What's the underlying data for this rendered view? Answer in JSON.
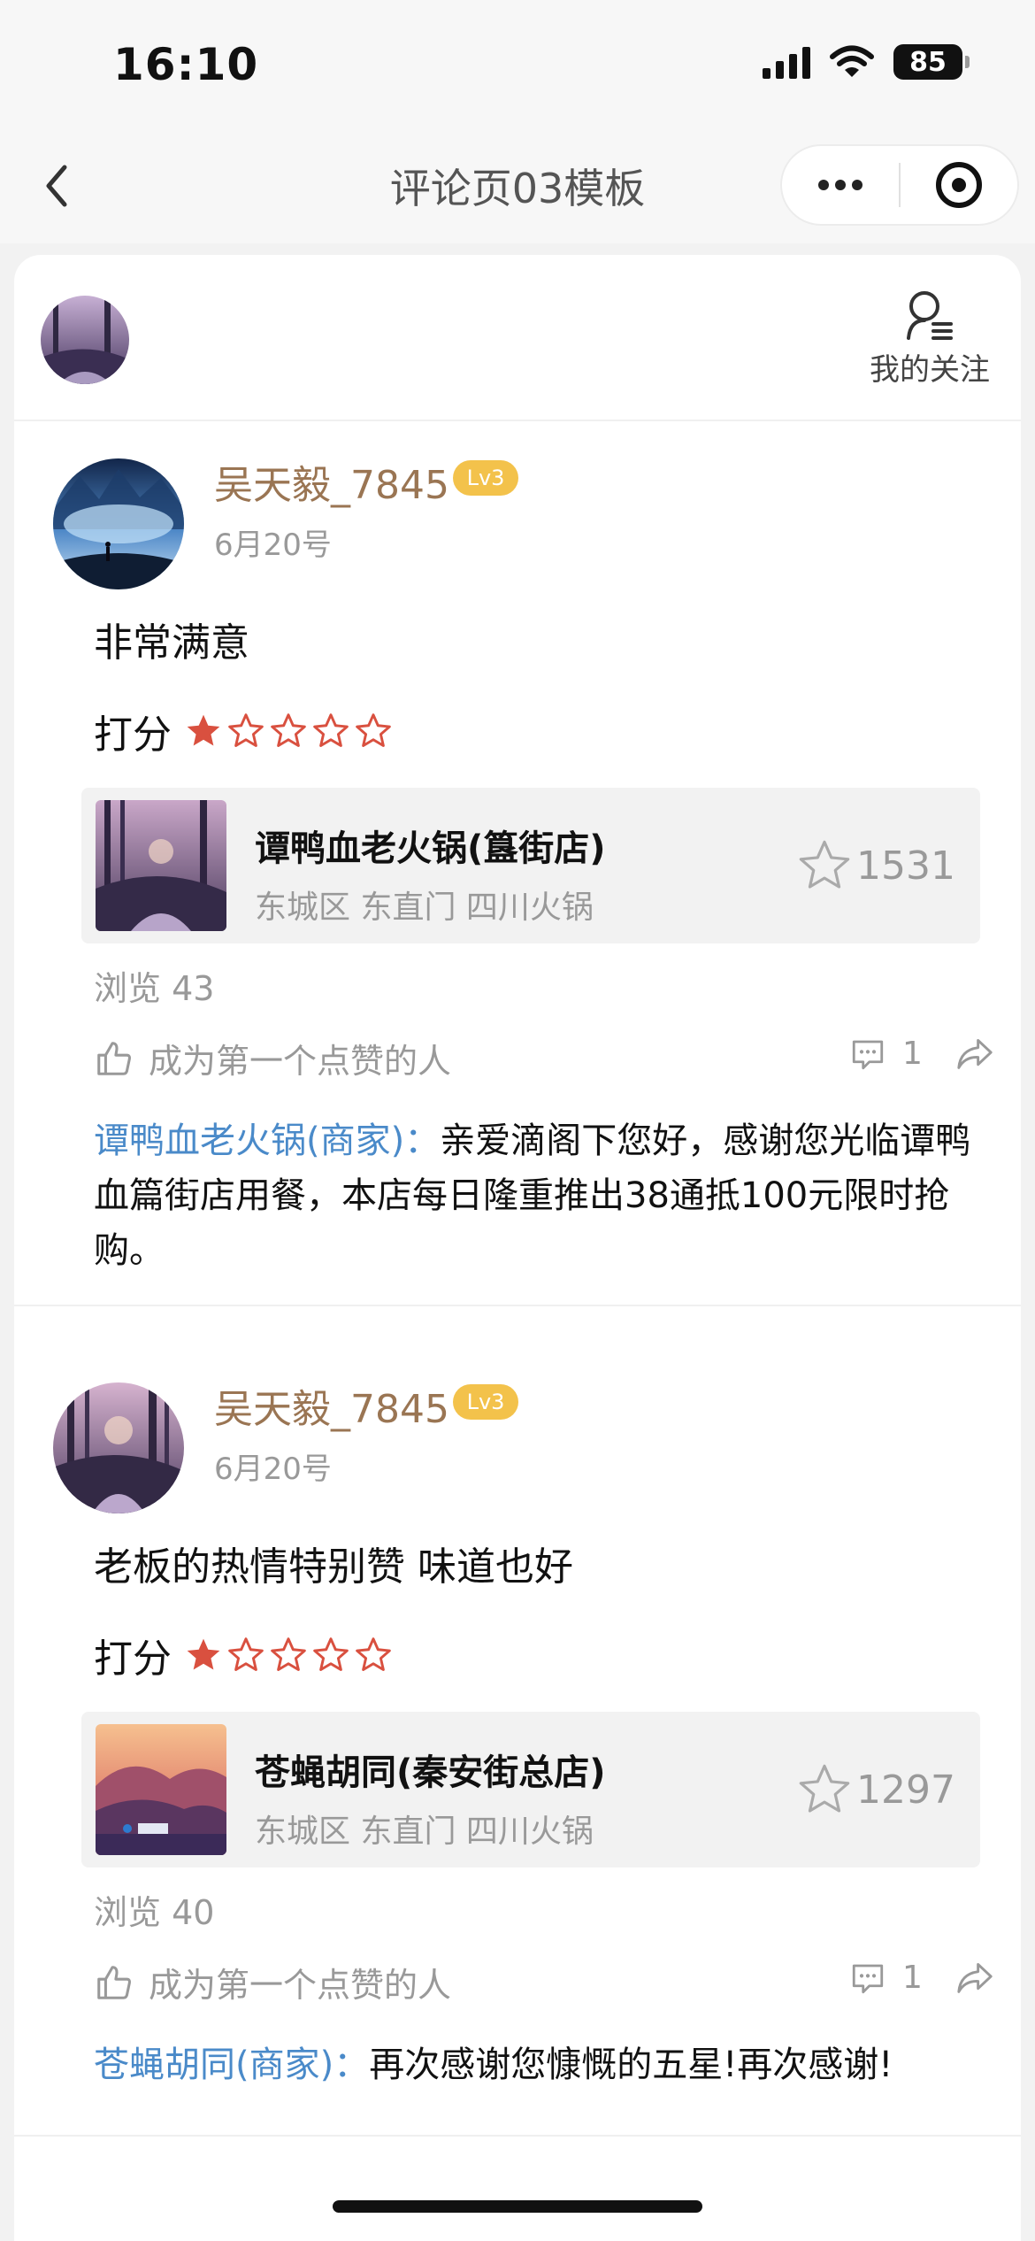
{
  "status_bar": {
    "time": "16:10",
    "battery": "85"
  },
  "nav": {
    "title": "评论页03模板"
  },
  "header": {
    "follow_label": "我的关注"
  },
  "reviews": [
    {
      "username": "吴天毅_7845",
      "level": "Lv3",
      "date": "6月20号",
      "text": "非常满意",
      "score_label": "打分",
      "rating": 1,
      "max_rating": 5,
      "shop": {
        "name": "谭鸭血老火锅(簋街店)",
        "location": "东城区 东直门 四川火锅",
        "fav_count": "1531"
      },
      "views": "浏览 43",
      "like_text": "成为第一个点赞的人",
      "comment_count": "1",
      "reply_merchant": "谭鸭血老火锅(商家)：",
      "reply_text": "亲爱滴阁下您好，感谢您光临谭鸭血篇街店用餐，本店每日隆重推出38通抵100元限时抢购。"
    },
    {
      "username": "吴天毅_7845",
      "level": "Lv3",
      "date": "6月20号",
      "text": "老板的热情特别赞 味道也好",
      "score_label": "打分",
      "rating": 1,
      "max_rating": 5,
      "shop": {
        "name": "苍蝇胡同(秦安街总店)",
        "location": "东城区 东直门 四川火锅",
        "fav_count": "1297"
      },
      "views": "浏览 40",
      "like_text": "成为第一个点赞的人",
      "comment_count": "1",
      "reply_merchant": "苍蝇胡同(商家)：",
      "reply_text": "再次感谢您慷慨的五星!再次感谢!"
    }
  ],
  "colors": {
    "username": "#9a7553",
    "level_badge": "#f3c24b",
    "star_active": "#d9503f",
    "merchant_link": "#4a8ac9"
  }
}
